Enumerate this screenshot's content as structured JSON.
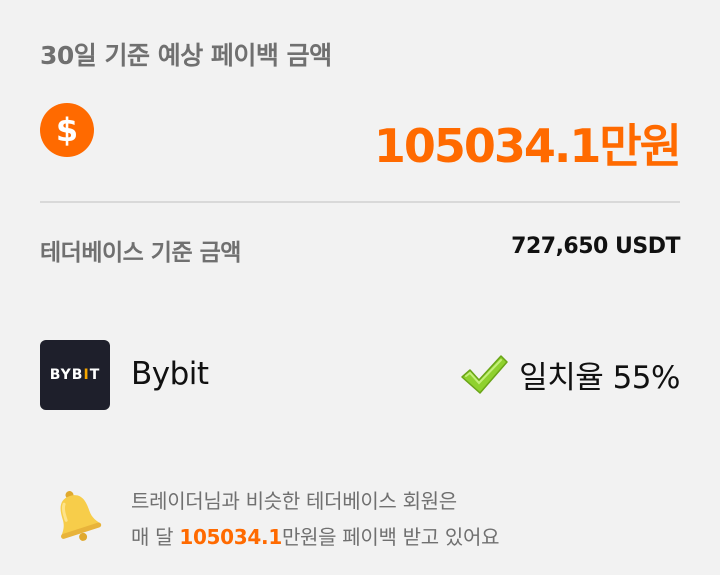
{
  "header": {
    "title": "30일 기준 예상 페이백 금액"
  },
  "payback": {
    "currency_icon_glyph": "$",
    "amount": "105034.1만원"
  },
  "base": {
    "label": "테더베이스 기준 금액",
    "value": "727,650 USDT"
  },
  "exchange": {
    "logo_text_left": "BYB",
    "logo_text_accent": "I",
    "logo_text_right": "T",
    "name": "Bybit",
    "match_icon": "check-icon",
    "match_text": "일치율 55%"
  },
  "note": {
    "icon": "bell-icon",
    "line1": "트레이더님과 비슷한 테더베이스 회원은",
    "line2_prefix": "매 달 ",
    "line2_amount": "105034.1",
    "line2_suffix": "만원을 페이백 받고 있어요"
  },
  "colors": {
    "accent": "#ff6a00",
    "background": "#f2f2f2",
    "muted_text": "#707070",
    "logo_bg": "#1e1f2b",
    "logo_accent": "#f7a600",
    "check_green": "#8fd12e"
  }
}
